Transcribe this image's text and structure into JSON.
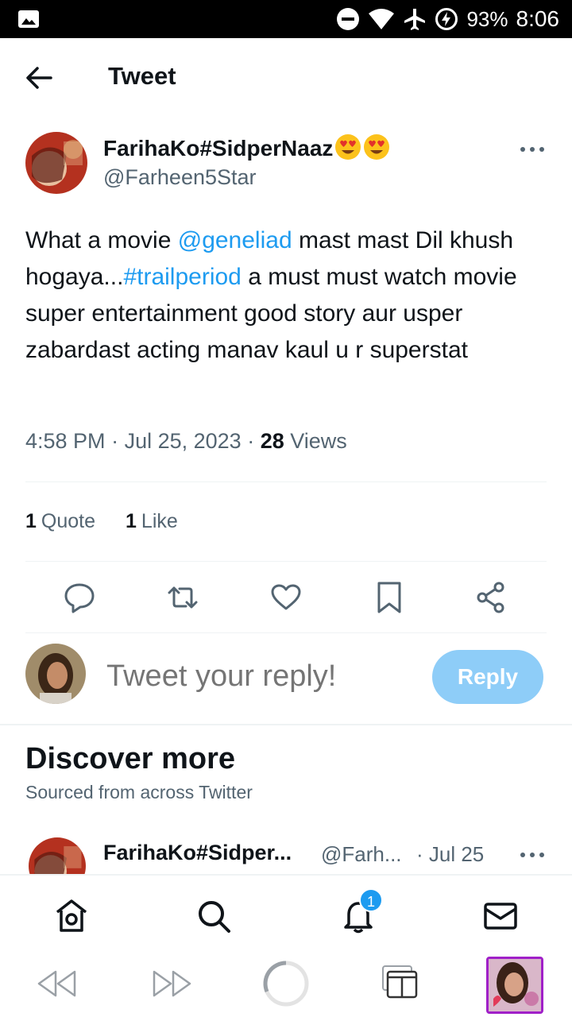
{
  "status_bar": {
    "battery": "93%",
    "time": "8:06"
  },
  "header": {
    "title": "Tweet"
  },
  "tweet": {
    "author_name": "FarihaKo#SidperNaaz",
    "author_handle": "@Farheen5Star",
    "text_1": "What a movie ",
    "mention": "@geneliad",
    "text_2": " mast mast Dil khush hogaya...",
    "hashtag": "#trailperiod",
    "text_3": " a must must watch movie super entertainment good story aur usper zabardast acting manav kaul u r superstat",
    "time": "4:58 PM",
    "date": "Jul 25, 2023",
    "views_count": "28",
    "views_label": "Views",
    "quotes_count": "1",
    "quotes_label": "Quote",
    "likes_count": "1",
    "likes_label": "Like"
  },
  "reply": {
    "placeholder": "Tweet your reply!",
    "button": "Reply"
  },
  "discover": {
    "title": "Discover more",
    "subtitle": "Sourced from across Twitter",
    "first_item": {
      "name": "FarihaKo#Sidper...",
      "handle": "@Farh...",
      "time": "· Jul 25"
    }
  },
  "bottom_nav": {
    "notifications_badge": "1"
  },
  "colors": {
    "accent": "#1d9bf0",
    "reply_disabled": "#8ecdf8",
    "secondary_text": "#536471"
  }
}
